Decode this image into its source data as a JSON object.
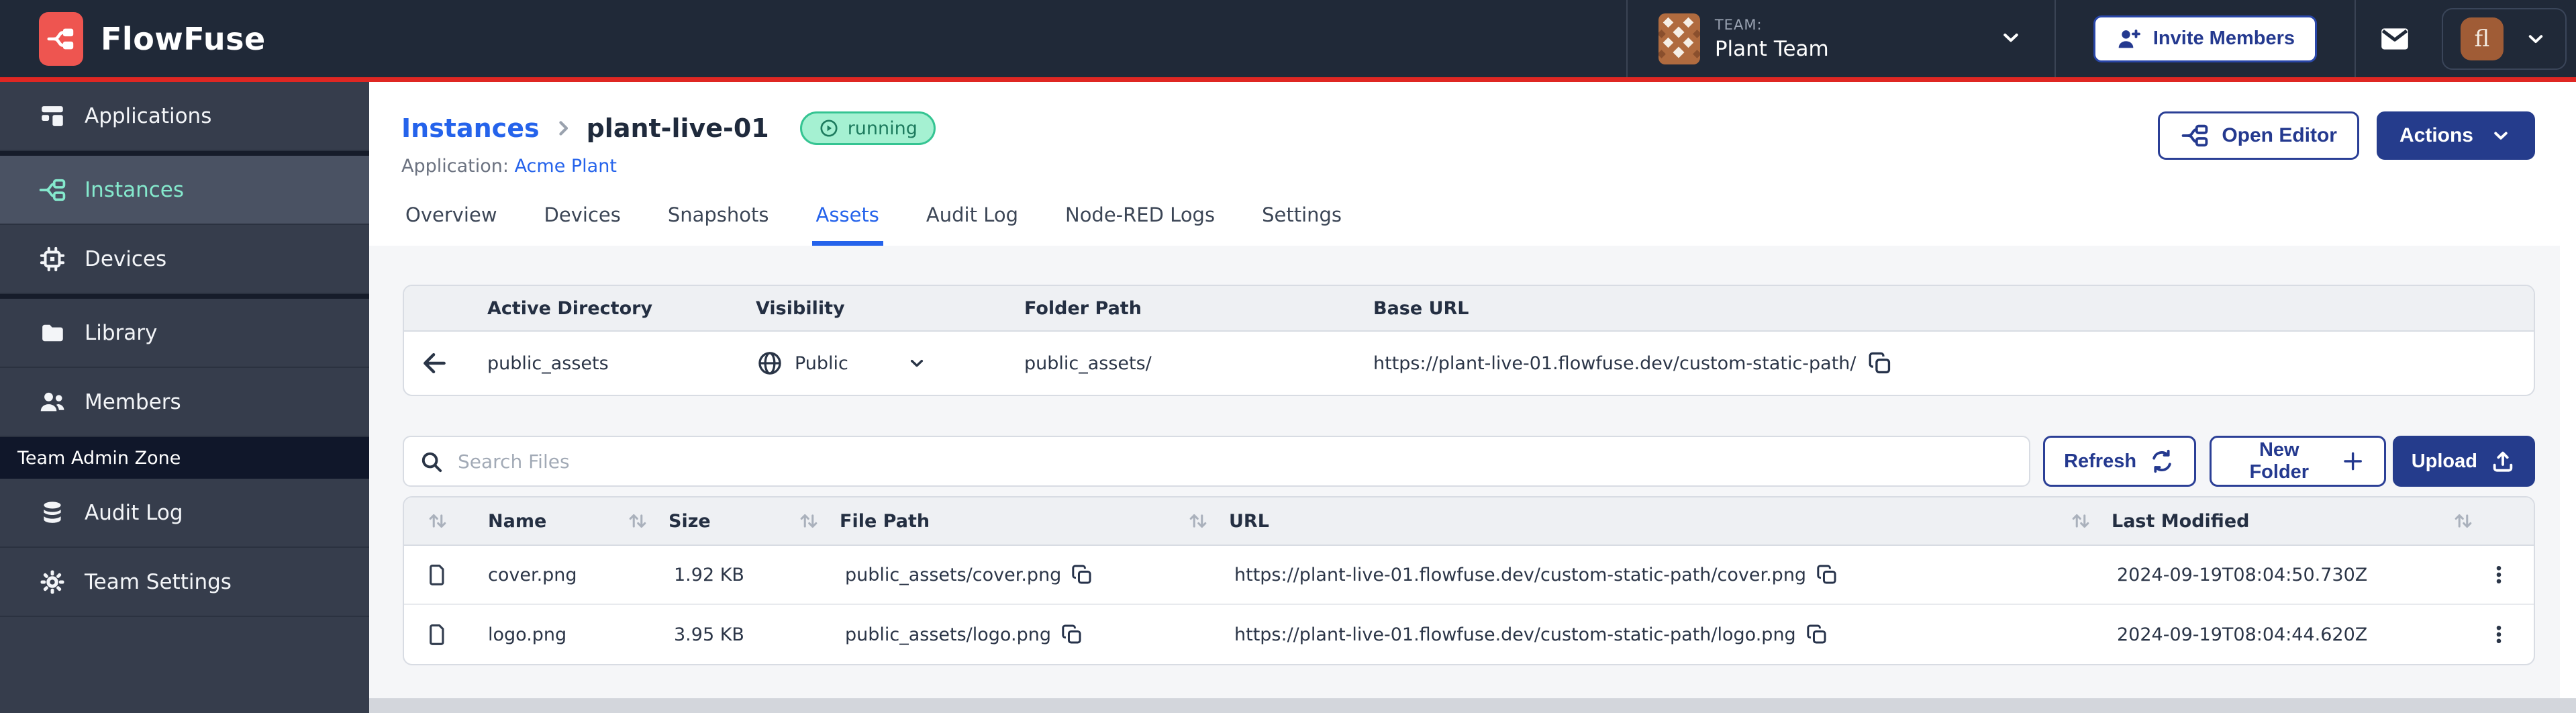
{
  "brand": {
    "name": "FlowFuse",
    "accent_red": "#df2723",
    "navy": "#253c8c",
    "link_blue": "#2563eb"
  },
  "navbar": {
    "team_label": "TEAM:",
    "team_name": "Plant Team",
    "invite_label": "Invite Members",
    "avatar_initials": "fl"
  },
  "sidebar": {
    "items": [
      {
        "label": "Applications",
        "icon": "applications-icon"
      },
      {
        "label": "Instances",
        "icon": "instances-icon",
        "active": true
      },
      {
        "label": "Devices",
        "icon": "devices-icon"
      },
      {
        "label": "Library",
        "icon": "library-icon"
      },
      {
        "label": "Members",
        "icon": "members-icon"
      }
    ],
    "admin_zone_label": "Team Admin Zone",
    "admin_items": [
      {
        "label": "Audit Log",
        "icon": "audit-log-icon"
      },
      {
        "label": "Team Settings",
        "icon": "gear-icon"
      }
    ]
  },
  "header": {
    "breadcrumb_root": "Instances",
    "instance_name": "plant-live-01",
    "status_label": "running",
    "application_label": "Application:",
    "application_name": "Acme Plant",
    "open_editor_label": "Open Editor",
    "actions_label": "Actions"
  },
  "tabs": [
    "Overview",
    "Devices",
    "Snapshots",
    "Assets",
    "Audit Log",
    "Node-RED Logs",
    "Settings"
  ],
  "active_tab": "Assets",
  "directory": {
    "col_active": "Active Directory",
    "col_visibility": "Visibility",
    "col_folder": "Folder Path",
    "col_base": "Base URL",
    "name": "public_assets",
    "visibility": "Public",
    "folder_path": "public_assets/",
    "base_url": "https://plant-live-01.flowfuse.dev/custom-static-path/"
  },
  "toolbar": {
    "search_placeholder": "Search Files",
    "refresh_label": "Refresh",
    "new_folder_label": "New Folder",
    "upload_label": "Upload"
  },
  "files": {
    "columns": {
      "name": "Name",
      "size": "Size",
      "path": "File Path",
      "url": "URL",
      "modified": "Last Modified"
    },
    "rows": [
      {
        "name": "cover.png",
        "size": "1.92 KB",
        "path": "public_assets/cover.png",
        "url": "https://plant-live-01.flowfuse.dev/custom-static-path/cover.png",
        "modified": "2024-09-19T08:04:50.730Z"
      },
      {
        "name": "logo.png",
        "size": "3.95 KB",
        "path": "public_assets/logo.png",
        "url": "https://plant-live-01.flowfuse.dev/custom-static-path/logo.png",
        "modified": "2024-09-19T08:04:44.620Z"
      }
    ]
  }
}
